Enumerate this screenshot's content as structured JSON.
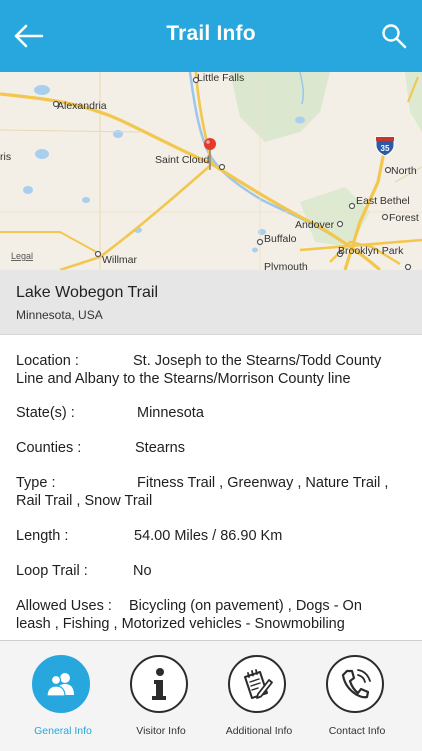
{
  "header": {
    "title": "Trail Info"
  },
  "map": {
    "labels": {
      "little_falls": "Little Falls",
      "alexandria": "Alexandria",
      "saint_cloud": "Saint Cloud",
      "ris": "ris",
      "north": "North",
      "east_bethel": "East Bethel",
      "forest": "Forest",
      "andover": "Andover",
      "buffalo": "Buffalo",
      "brooklyn_park": "Brooklyn Park",
      "willmar": "Willmar",
      "plymouth": "Plymouth",
      "legal": "Legal",
      "interstate": "35"
    }
  },
  "trail": {
    "name": "Lake Wobegon Trail",
    "location": "Minnesota, USA"
  },
  "details": {
    "location_label": "Location  :",
    "location_value": "St. Joseph to the Stearns/Todd County",
    "location_value_cont": "Line and Albany to the Stearns/Morrison County line",
    "state_label": "State(s)  :",
    "state_value": "Minnesota",
    "counties_label": "Counties  :",
    "counties_value": "Stearns",
    "type_label": "Type  :",
    "type_value": "Fitness Trail , Greenway , Nature Trail ,",
    "type_value_cont": "Rail Trail , Snow Trail",
    "length_label": "Length  :",
    "length_value": "54.00 Miles / 86.90 Km",
    "loop_label": "Loop Trail  :",
    "loop_value": "No",
    "uses_label": "Allowed Uses  :",
    "uses_value": "Bicycling (on pavement) , Dogs - On",
    "uses_value_cont": "leash , Fishing , Motorized vehicles - Snowmobiling"
  },
  "tabs": [
    {
      "label": "General Info",
      "icon": "group-icon"
    },
    {
      "label": "Visitor Info",
      "icon": "info-icon"
    },
    {
      "label": "Additional Info",
      "icon": "notepad-pencil-icon"
    },
    {
      "label": "Contact Info",
      "icon": "phone-icon"
    }
  ],
  "colors": {
    "accent": "#27a7dd",
    "header_text": "#ffffff",
    "panel": "#e6e6e6"
  }
}
